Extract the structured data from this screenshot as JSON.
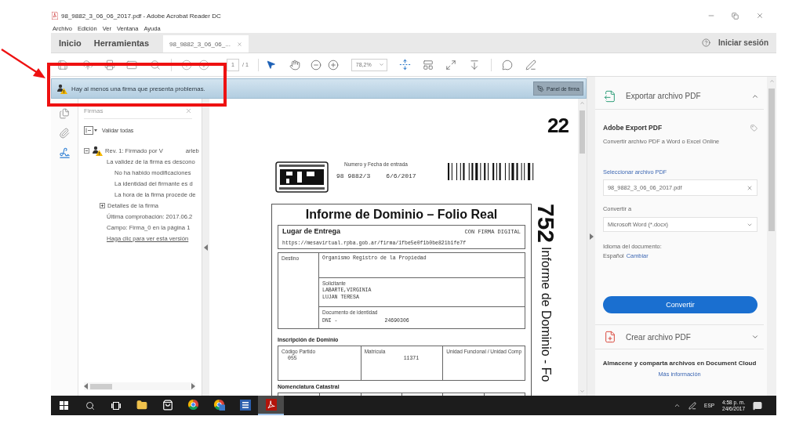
{
  "window": {
    "title": "98_9882_3_06_06_2017.pdf - Adobe Acrobat Reader DC"
  },
  "menu": [
    "Archivo",
    "Edición",
    "Ver",
    "Ventana",
    "Ayuda"
  ],
  "tabs": [
    {
      "kind": "section",
      "label": "Inicio",
      "selected": false
    },
    {
      "kind": "section",
      "label": "Herramientas",
      "selected": false
    },
    {
      "kind": "document",
      "label": "98_9882_3_06_06_...",
      "selected": true
    }
  ],
  "account": {
    "label": "Iniciar sesión"
  },
  "toolbar": {
    "page": "1",
    "page_total": "/ 1",
    "zoom": "78,2%"
  },
  "notification": {
    "message": "Hay al menos una firma que presenta problemas.",
    "button": "Panel de firma"
  },
  "side_tools": [
    {
      "kind": "pages",
      "selected": false
    },
    {
      "kind": "attachments",
      "selected": false
    },
    {
      "kind": "signatures",
      "selected": true
    }
  ],
  "signatures": {
    "title": "Firmas",
    "validate_all": "Validar todas",
    "tree": [
      {
        "kind": "signature",
        "label": "Rev. 1: Firmado por V",
        "label_tail": "arleb",
        "expanded": true,
        "children": [
          {
            "kind": "text",
            "label": "La validez de la firma es descono",
            "children": [
              {
                "kind": "text",
                "label": "No ha habido modificaciones"
              },
              {
                "kind": "text",
                "label": "La identidad del firmante es d"
              },
              {
                "kind": "text",
                "label": "La hora de la firma procede de"
              }
            ]
          },
          {
            "kind": "expander",
            "label": "Detalles de la firma",
            "expanded": false
          },
          {
            "kind": "text",
            "label": "Última comprobación: 2017.06.2"
          },
          {
            "kind": "text",
            "label": "Campo: Firma_0 en la página 1"
          },
          {
            "kind": "link",
            "label": "Haga clic para ver esta versión"
          }
        ]
      }
    ]
  },
  "document": {
    "page_number": "22",
    "entry_label": "Numero y Fecha de entrada",
    "entry_number": "98 9882/3",
    "entry_date": "6/6/2017",
    "title": "Informe de Dominio – Folio Real",
    "delivery": {
      "label": "Lugar de Entrega",
      "mode": "CON FIRMA DIGITAL",
      "url": "https://mesavirtual.rpba.gob.ar/firma/1fbe5e0f1b0be821b1fe7f"
    },
    "destination": {
      "label": "Destino",
      "value": "Organismo Registro de la Propiedad"
    },
    "applicant": {
      "label": "Solicitante",
      "lines": [
        "LABARTE,VIRGINIA",
        "LUJAN TERESA"
      ]
    },
    "identity": {
      "label": "Documento de identidad",
      "type": "DNI -",
      "number": "24690306"
    },
    "inscription": {
      "heading": "Inscripción de Dominio",
      "cells": [
        {
          "label": "Código Partido",
          "value": "055"
        },
        {
          "label": "Matrícula",
          "value": "11371"
        },
        {
          "label": "Unidad Funcional / Unidad Comp"
        }
      ]
    },
    "cadastral_heading": "Nomenclatura Catastral",
    "side_number": "752",
    "side_title": "Informe de Dominio - Fo"
  },
  "tools_panel": {
    "sections": [
      {
        "kind": "export",
        "title": "Exportar archivo PDF",
        "expanded": true
      },
      {
        "kind": "create",
        "title": "Crear archivo PDF",
        "expanded": false
      }
    ],
    "export": {
      "service": "Adobe Export PDF",
      "description": "Convertir archivo PDF a Word o Excel Online",
      "file_label": "Seleccionar archivo PDF",
      "file": "98_9882_3_06_06_2017.pdf",
      "format_label": "Convertir a",
      "format": "Microsoft Word (*.docx)",
      "language_label": "Idioma del documento:",
      "language": "Español",
      "language_link": "Cambiar",
      "button": "Convertir"
    },
    "cloud": {
      "message": "Almacene y comparta archivos en Document Cloud",
      "link": "Más información"
    }
  },
  "taskbar": {
    "apps": [
      {
        "kind": "explorer",
        "selected": false
      },
      {
        "kind": "store",
        "selected": false
      },
      {
        "kind": "chrome",
        "selected": false
      },
      {
        "kind": "chrome-app",
        "selected": false
      },
      {
        "kind": "word",
        "selected": false
      },
      {
        "kind": "acrobat",
        "selected": true
      }
    ],
    "language": "ESP",
    "time": "4:58 p. m.",
    "date": "24/6/2017"
  }
}
